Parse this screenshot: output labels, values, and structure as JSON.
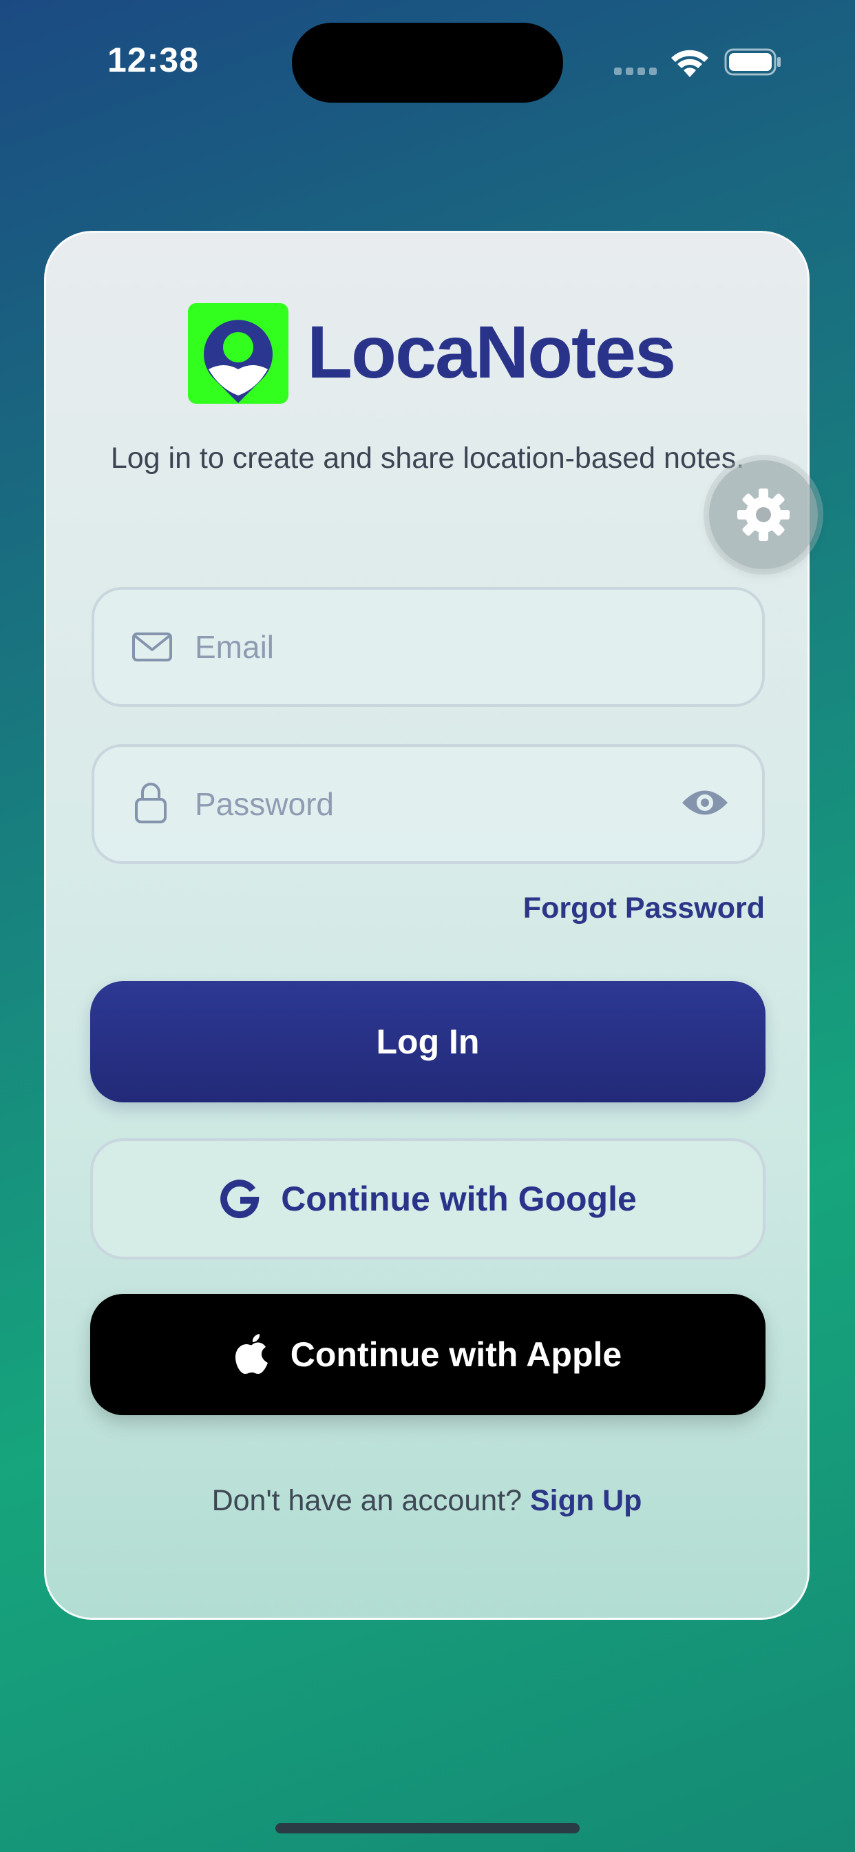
{
  "status_bar": {
    "time": "12:38",
    "icons": [
      "signal-icon",
      "wifi-icon",
      "battery-icon"
    ]
  },
  "brand": {
    "name": "LocaNotes",
    "logo_icon": "location-pin-icon",
    "logo_color": "#33ff1e",
    "primary_color": "#29338a"
  },
  "tagline": "Log in to create and share location-based notes.",
  "settings": {
    "icon": "gear-icon"
  },
  "form": {
    "email": {
      "placeholder": "Email",
      "value": "",
      "icon": "mail-icon"
    },
    "password": {
      "placeholder": "Password",
      "value": "",
      "icon": "lock-icon",
      "toggle_icon": "eye-icon"
    },
    "forgot_label": "Forgot Password",
    "login_label": "Log In",
    "google_label": "Continue with Google",
    "apple_label": "Continue with Apple"
  },
  "signup": {
    "prompt": "Don't have an account?",
    "link_label": "Sign Up"
  }
}
